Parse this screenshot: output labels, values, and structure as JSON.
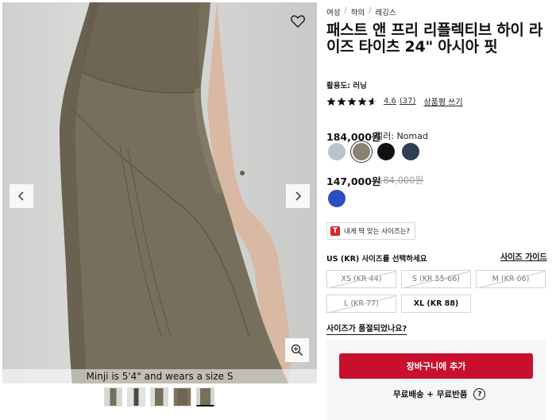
{
  "breadcrumb": [
    "여성",
    "하의",
    "레깅스"
  ],
  "product": {
    "title": "패스트 앤 프리 리플렉티브 하이 라이즈 타이츠 24\" 아시아 핏",
    "activity": "활용도: 러닝"
  },
  "rating": {
    "stars": 4.6,
    "value": "4.6",
    "count": "(37)",
    "write_review": "상품평 쓰기"
  },
  "price_main": "184,000원",
  "color_label": "컬러: Nomad",
  "swatches_main": [
    {
      "name": "light-blue-grey",
      "color": "#b8c3cc",
      "selected": false
    },
    {
      "name": "nomad",
      "color": "#8a8170",
      "selected": true
    },
    {
      "name": "black",
      "color": "#111111",
      "selected": false
    },
    {
      "name": "navy",
      "color": "#2f3d55",
      "selected": false
    }
  ],
  "price_sale": "147,000원",
  "price_original": "184,000원",
  "swatches_sale": [
    {
      "name": "blue",
      "color": "#2a4fc0"
    }
  ],
  "fit_finder": {
    "badge": "T",
    "label": "내게 딱 맞는 사이즈는?"
  },
  "size_heading": "US (KR) 사이즈를 선택하세요",
  "size_guide": "사이즈 가이드",
  "sizes": [
    {
      "label": "XS (KR 44)",
      "available": false
    },
    {
      "label": "S (KR 55-66)",
      "available": false
    },
    {
      "label": "M (KR 66)",
      "available": false
    },
    {
      "label": "L (KR 77)",
      "available": false
    },
    {
      "label": "XL (KR 88)",
      "available": true
    }
  ],
  "sold_out_question": "사이즈가 품절되었나요?",
  "add_to_cart": "장바구니에 추가",
  "shipping": "무료배송 + 무료반품",
  "help_glyph": "?",
  "image_caption": "Minji is 5'4\" and wears a size S",
  "thumbnails": 5,
  "icons": {
    "wishlist": "heart-icon",
    "prev": "chevron-left-icon",
    "next": "chevron-right-icon",
    "zoom": "zoom-in-icon",
    "help": "question-circle-icon"
  },
  "colors": {
    "accent": "#c8102e",
    "legging": "#7a7562"
  }
}
